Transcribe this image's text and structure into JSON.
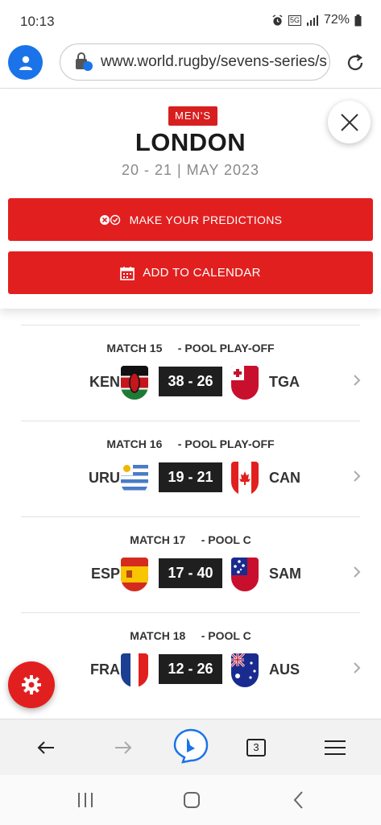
{
  "status_bar": {
    "time": "10:13",
    "network": "5G",
    "battery": "72%"
  },
  "browser": {
    "url": "www.world.rugby/sevens-series/s",
    "tab_count": "3"
  },
  "event": {
    "badge": "MEN'S",
    "title": "LONDON",
    "dates": "20 - 21 | MAY 2023",
    "predict_label": "MAKE YOUR PREDICTIONS",
    "calendar_label": "ADD TO CALENDAR"
  },
  "matches": [
    {
      "label": "MATCH 15     - POOL PLAY-OFF",
      "home": "KEN",
      "score": "38 - 26",
      "away": "TGA",
      "home_flag": "kenya-flag-icon",
      "away_flag": "tonga-flag-icon"
    },
    {
      "label": "MATCH 16     - POOL PLAY-OFF",
      "home": "URU",
      "score": "19 - 21",
      "away": "CAN",
      "home_flag": "uruguay-flag-icon",
      "away_flag": "canada-flag-icon"
    },
    {
      "label": "MATCH 17     - POOL C",
      "home": "ESP",
      "score": "17 - 40",
      "away": "SAM",
      "home_flag": "spain-flag-icon",
      "away_flag": "samoa-flag-icon"
    },
    {
      "label": "MATCH 18     - POOL C",
      "home": "FRA",
      "score": "12 - 26",
      "away": "AUS",
      "home_flag": "france-flag-icon",
      "away_flag": "australia-flag-icon"
    }
  ],
  "colors": {
    "accent_red": "#e21f1f",
    "score_bg": "#1f1f1f",
    "browser_blue": "#1a73e8"
  }
}
